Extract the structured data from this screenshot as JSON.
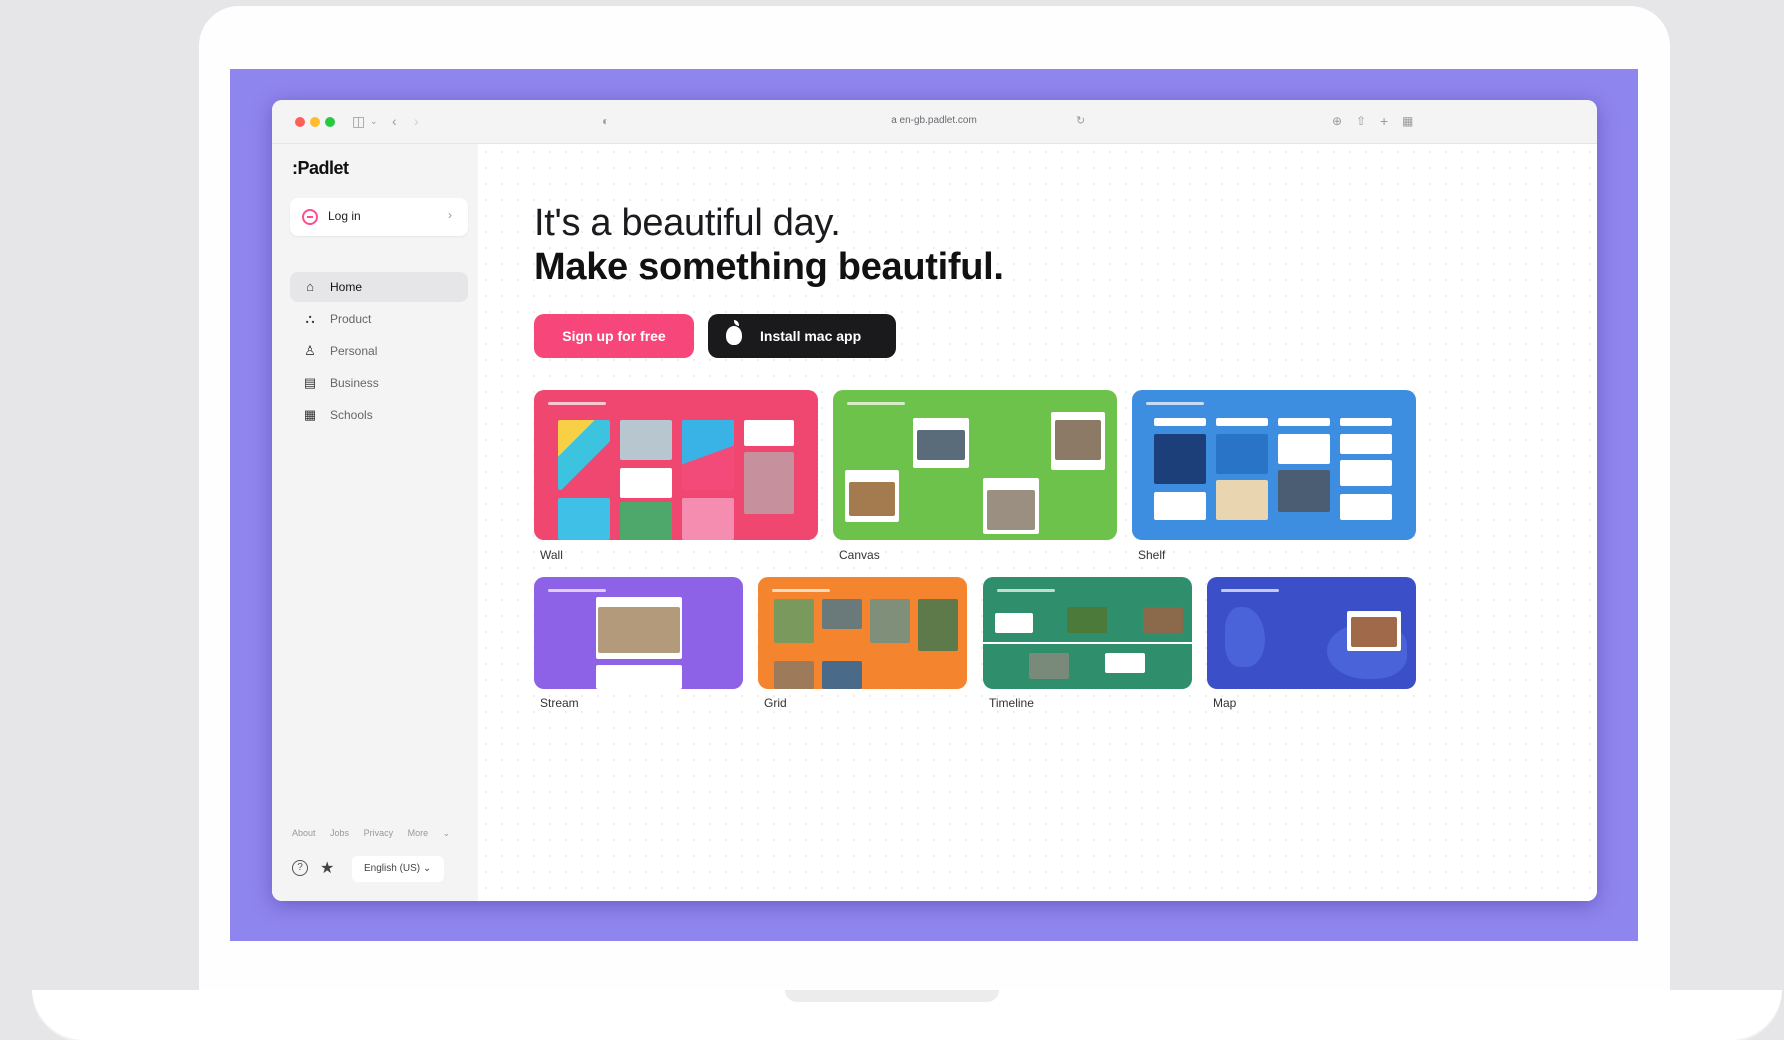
{
  "browser": {
    "url": "a en-gb.padlet.com"
  },
  "sidebar": {
    "logo": "Padlet",
    "login_label": "Log in",
    "items": [
      {
        "label": "Home",
        "icon": "home-icon",
        "active": true
      },
      {
        "label": "Product",
        "icon": "building-icon",
        "active": false
      },
      {
        "label": "Personal",
        "icon": "person-icon",
        "active": false
      },
      {
        "label": "Business",
        "icon": "store-icon",
        "active": false
      },
      {
        "label": "Schools",
        "icon": "school-icon",
        "active": false
      }
    ],
    "footer_links": [
      "About",
      "Jobs",
      "Privacy",
      "More"
    ],
    "language": "English (US)"
  },
  "hero": {
    "line1": "It's a beautiful day.",
    "line2": "Make something beautiful.",
    "signup_label": "Sign up for free",
    "install_label": "Install mac app"
  },
  "templates": [
    {
      "label": "Wall",
      "color": "#ef476f"
    },
    {
      "label": "Canvas",
      "color": "#6cc24a"
    },
    {
      "label": "Shelf",
      "color": "#3d8ee0"
    },
    {
      "label": "Stream",
      "color": "#8e62e6"
    },
    {
      "label": "Grid",
      "color": "#f5842f"
    },
    {
      "label": "Timeline",
      "color": "#2f8f6d"
    },
    {
      "label": "Map",
      "color": "#3b4fc9"
    }
  ],
  "colors": {
    "screen_bg": "#8f85ee",
    "signup": "#f6467a",
    "install": "#1a1a1c"
  }
}
